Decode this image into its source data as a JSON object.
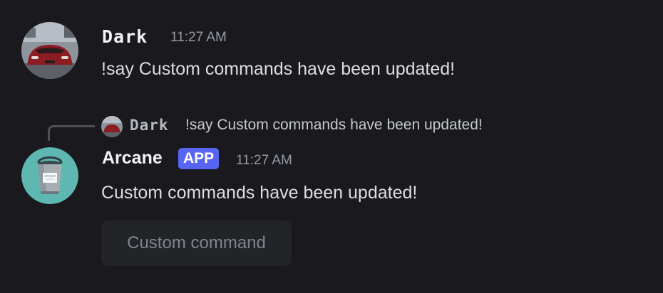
{
  "messages": [
    {
      "author": "Dark",
      "timestamp": "11:27 AM",
      "content": "!say Custom commands have been updated!",
      "avatar_icon": "red-car-avatar"
    },
    {
      "author": "Arcane",
      "badge": "APP",
      "timestamp": "11:27 AM",
      "content": "Custom commands have been updated!",
      "avatar_icon": "paint-bucket-avatar",
      "reply_to": {
        "author": "Dark",
        "content": "!say Custom commands have been updated!"
      },
      "button_label": "Custom command"
    }
  ],
  "colors": {
    "background": "#1a1a1e",
    "badge": "#5865f2",
    "arcane_avatar_bg": "#5fb7b2"
  }
}
